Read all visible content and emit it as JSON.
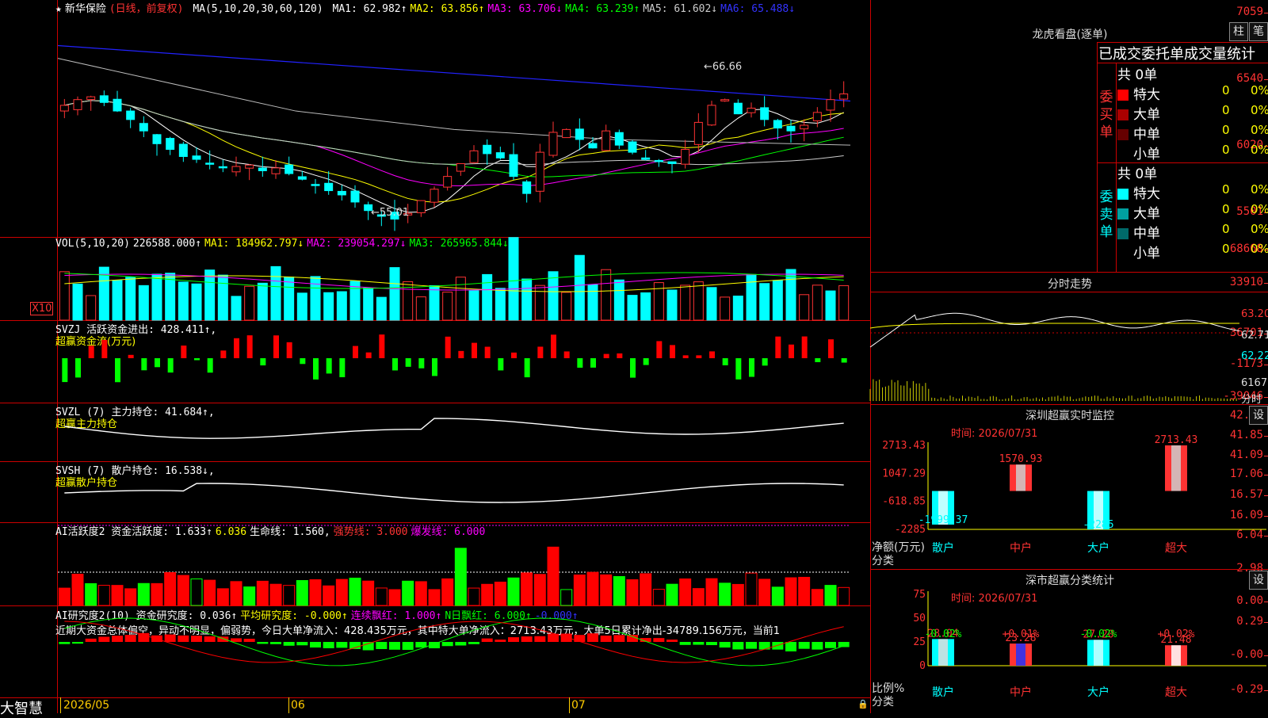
{
  "stock": {
    "star": "★",
    "name": "新华保险",
    "period": "(日线，前复权)"
  },
  "ma_line": {
    "label": "MA(5,10,20,30,60,120)",
    "items": [
      {
        "t": "MA1: 62.982↑",
        "c": "#ffffff"
      },
      {
        "t": "MA2: 63.856↑",
        "c": "#ffff00"
      },
      {
        "t": "MA3: 63.706↓",
        "c": "#ff00ff"
      },
      {
        "t": "MA4: 63.239↑",
        "c": "#00ff00"
      },
      {
        "t": "MA5: 61.602↓",
        "c": "#cccccc"
      },
      {
        "t": "MA6: 65.488↓",
        "c": "#3333ff"
      }
    ]
  },
  "price_axis": [
    "7059",
    "6540",
    "6020",
    "5501"
  ],
  "price_annot": {
    "high": "66.66",
    "low": "55.01"
  },
  "vol": {
    "title": "VOL(5,10,20)",
    "items": [
      {
        "t": "226588.000↑",
        "c": "#ffffff"
      },
      {
        "t": "MA1: 184962.797↓",
        "c": "#ffff00"
      },
      {
        "t": "MA2: 239054.297↓",
        "c": "#ff00ff"
      },
      {
        "t": "MA3: 265965.844↓",
        "c": "#00ff00"
      }
    ],
    "axis": [
      "68668",
      "33910"
    ],
    "unit": "X10"
  },
  "svzj": {
    "title": "SVZJ  活跃资金进出: 428.411↑,",
    "sub": "超赢资金流(万元)",
    "axis": [
      "36701",
      "-1173",
      "-39046"
    ]
  },
  "svzl": {
    "title": "SVZL (7) 主力持仓: 41.684↑,",
    "sub": "超赢主力持仓",
    "axis": [
      "42.61",
      "41.85",
      "41.09"
    ]
  },
  "svsh": {
    "title": "SVSH (7) 散户持仓: 16.538↓,",
    "sub": "超赢散户持仓",
    "axis": [
      "17.06",
      "16.57",
      "16.09"
    ]
  },
  "ai1": {
    "items": [
      {
        "t": "AI活跃度2 资金活跃度: 1.633↑",
        "c": "#ffffff"
      },
      {
        "t": "6.036",
        "c": "#ffff00"
      },
      {
        "t": "生命线: 1.560,",
        "c": "#ffffff"
      },
      {
        "t": "强势线: 3.000",
        "c": "#ff3333"
      },
      {
        "t": "爆发线: 6.000",
        "c": "#ff00ff"
      }
    ],
    "axis": [
      "6.04",
      "2.98",
      "0.00"
    ]
  },
  "ai2": {
    "items": [
      {
        "t": "AI研究度2(10) 资金研究度: 0.036↑",
        "c": "#ffffff"
      },
      {
        "t": "平均研究度: -0.000↑",
        "c": "#ffff00"
      },
      {
        "t": "连续飘红: 1.000↑",
        "c": "#ff00ff"
      },
      {
        "t": "N日飘红: 6.000↑",
        "c": "#00ff00"
      },
      {
        "t": "-0.000↑",
        "c": "#3333ff"
      }
    ],
    "text": "近期大资金总体偏空，异动不明显，偏弱势，今日大单净流入：428.435万元，其中特大单净流入：2713.43万元，大单5日累计净出-34789.156万元，当前1",
    "axis": [
      "0.29",
      "-0.00",
      "-0.29"
    ]
  },
  "x_axis": [
    "2026/05",
    "06",
    "07"
  ],
  "brand": "大智慧",
  "right": {
    "lh_title": "龙虎看盘(逐单)",
    "btn1": "柱",
    "btn2": "笔",
    "header": "已成交委托单成交量统计",
    "buy": {
      "side": "委买单",
      "total": "共 0单",
      "rows": [
        {
          "label": "特大",
          "color": "#ff0000",
          "v": "0",
          "p": "0%"
        },
        {
          "label": "大单",
          "color": "#aa0000",
          "v": "0",
          "p": "0%"
        },
        {
          "label": "中单",
          "color": "#660000",
          "v": "0",
          "p": "0%"
        },
        {
          "label": "小单",
          "color": "#000000",
          "v": "0",
          "p": "0%"
        }
      ]
    },
    "sell": {
      "side": "委卖单",
      "total": "共 0单",
      "rows": [
        {
          "label": "特大",
          "color": "#00ffff",
          "v": "0",
          "p": "0%"
        },
        {
          "label": "大单",
          "color": "#00a0a0",
          "v": "0",
          "p": "0%"
        },
        {
          "label": "中单",
          "color": "#006a6a",
          "v": "0",
          "p": "0%"
        },
        {
          "label": "小单",
          "color": "#000000",
          "v": "0",
          "p": "0%"
        }
      ]
    },
    "intraday": {
      "title": "分时走势",
      "axis": [
        "63.20",
        "62.71",
        "62.22"
      ],
      "vol": "6167",
      "vol_unit": "分时"
    },
    "sz_monitor": {
      "title": "深圳超赢实时监控",
      "set": "设",
      "time": "时间: 2026/07/31",
      "axis": [
        "2713.43",
        "1047.29",
        "-618.85",
        "-2285"
      ],
      "ylabel": "净额(万元)",
      "xlabel": "分类",
      "cats": [
        "散户",
        "中户",
        "大户",
        "超大"
      ],
      "vals": [
        -1999.37,
        1570.93,
        -2285,
        2713.43
      ],
      "labels": [
        "-1999.37",
        "1570.93",
        "-2285",
        "2713.43"
      ]
    },
    "sz_class": {
      "title": "深市超赢分类统计",
      "set": "设",
      "time": "时间: 2026/07/31",
      "axis": [
        "75",
        "50",
        "25",
        "0"
      ],
      "ylabel": "比例%",
      "xlabel": "分类",
      "cats": [
        "散户",
        "中户",
        "大户",
        "超大"
      ],
      "vals": [
        28.04,
        23.28,
        27.2,
        21.48
      ],
      "labels": [
        "28.04",
        "23.28",
        "27.20",
        "21.48"
      ],
      "deltas": [
        "-0.02%",
        "+0.01%",
        "-0.02%",
        "+0.02%"
      ]
    }
  },
  "colors": {
    "up": "#ff3333",
    "down": "#00ffff",
    "grid": "#cc0000"
  }
}
